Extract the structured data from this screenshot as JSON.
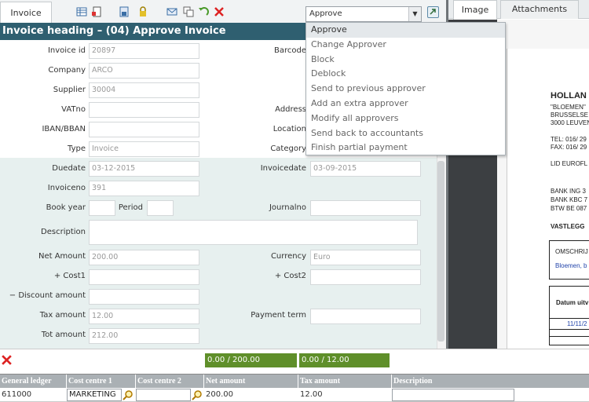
{
  "left_tab": "Invoice",
  "action_select": {
    "value": "Approve",
    "options": [
      "Approve",
      "Change Approver",
      "Block",
      "Deblock",
      "Send to previous approver",
      "Add an extra approver",
      "Modify all approvers",
      "Send back to accountants",
      "Finish partial payment"
    ]
  },
  "heading": "Invoice heading – (04) Approve Invoice",
  "form": {
    "invoice_id": {
      "label": "Invoice id",
      "value": "20897"
    },
    "company": {
      "label": "Company",
      "value": "ARCO"
    },
    "supplier": {
      "label": "Supplier",
      "value": "30004"
    },
    "vatno": {
      "label": "VATno",
      "value": ""
    },
    "iban": {
      "label": "IBAN/BBAN",
      "value": ""
    },
    "type": {
      "label": "Type",
      "value": "Invoice"
    },
    "barcode": {
      "label": "Barcode",
      "value": ""
    },
    "address": {
      "label": "Address",
      "value": ""
    },
    "location": {
      "label": "Location",
      "value": ""
    },
    "category": {
      "label": "Category",
      "value": ""
    },
    "duedate": {
      "label": "Duedate",
      "value": "03-12-2015"
    },
    "invoicedate": {
      "label": "Invoicedate",
      "value": "03-09-2015"
    },
    "invoiceno": {
      "label": "Invoiceno",
      "value": "391"
    },
    "book_year": {
      "label": "Book year",
      "value": ""
    },
    "period": {
      "label": "Period",
      "value": ""
    },
    "journalno": {
      "label": "Journalno",
      "value": ""
    },
    "description": {
      "label": "Description",
      "value": ""
    },
    "net_amount": {
      "label": "Net Amount",
      "value": "200.00"
    },
    "currency": {
      "label": "Currency",
      "value": "Euro"
    },
    "cost1": {
      "label": "+ Cost1",
      "value": ""
    },
    "cost2": {
      "label": "+ Cost2",
      "value": ""
    },
    "discount": {
      "label": "− Discount amount",
      "value": ""
    },
    "tax_amount": {
      "label": "Tax amount",
      "value": "12.00"
    },
    "payment_term": {
      "label": "Payment term",
      "value": ""
    },
    "tot_amount": {
      "label": "Tot amount",
      "value": "212.00"
    }
  },
  "right_tabs": {
    "image": "Image",
    "attachments": "Attachments"
  },
  "document": {
    "company": "HOLLAN",
    "addr1": "\"BLOEMEN\"",
    "addr2": "BRUSSELSE",
    "addr3": "3000 LEUVEN",
    "tel": "TEL:  016/ 29",
    "fax": "FAX:  016/ 29",
    "lid": "LID EUROFL",
    "bank1": "BANK ING  3",
    "bank2": "BANK KBC 7",
    "btw": "BTW BE 087",
    "vast": "VASTLEGG",
    "omsch": "OMSCHRIJ",
    "bloemen": "Bloemen, b",
    "datum": "Datum uitv",
    "date": "11/11/2"
  },
  "totals": {
    "net": "0.00 / 200.00",
    "tax": "0.00 / 12.00"
  },
  "grid": {
    "headers": [
      "General ledger",
      "Cost centre 1",
      "Cost centre 2",
      "Net amount",
      "Tax amount",
      "Description"
    ],
    "row": {
      "ledger": "611000",
      "cc1": "MARKETING",
      "cc2": "",
      "net": "200.00",
      "tax": "12.00",
      "desc": ""
    }
  },
  "colors": {
    "heading_bg": "#2f5f70",
    "totals_bg": "#5f8f2a",
    "lower_form_bg": "#e7f0ef"
  }
}
